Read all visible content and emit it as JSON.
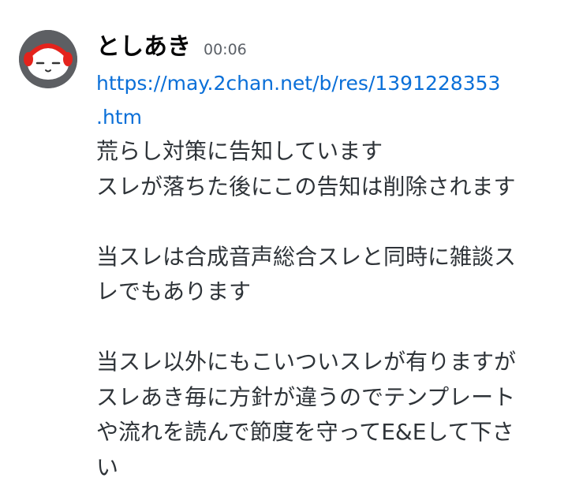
{
  "message": {
    "author": {
      "name": "としあき",
      "avatar_icon": "red-headphones-face-avatar-icon",
      "avatar_colors": {
        "background": "#5d5f63",
        "headphones": "#e4231c",
        "face": "#ffffff"
      }
    },
    "timestamp": "00:06",
    "link": {
      "line1": "https://may.2chan.net/b/res/1391228353",
      "line2": ".htm"
    },
    "paragraphs": [
      {
        "lines": [
          "荒らし対策に告知しています",
          "スレが落ちた後にこの告知は削除されます"
        ]
      },
      {
        "lines": [
          "当スレは合成音声総合スレと同時に雑談ス",
          "レでもあります"
        ]
      },
      {
        "lines": [
          "当スレ以外にもこいついスレが有りますが",
          "スレあき毎に方針が違うのでテンプレート",
          "や流れを読んで節度を守ってE&Eして下さ",
          "い"
        ]
      }
    ]
  },
  "colors": {
    "link": "#0a6fd8",
    "text": "#2e3338",
    "timestamp": "#5c6168"
  }
}
